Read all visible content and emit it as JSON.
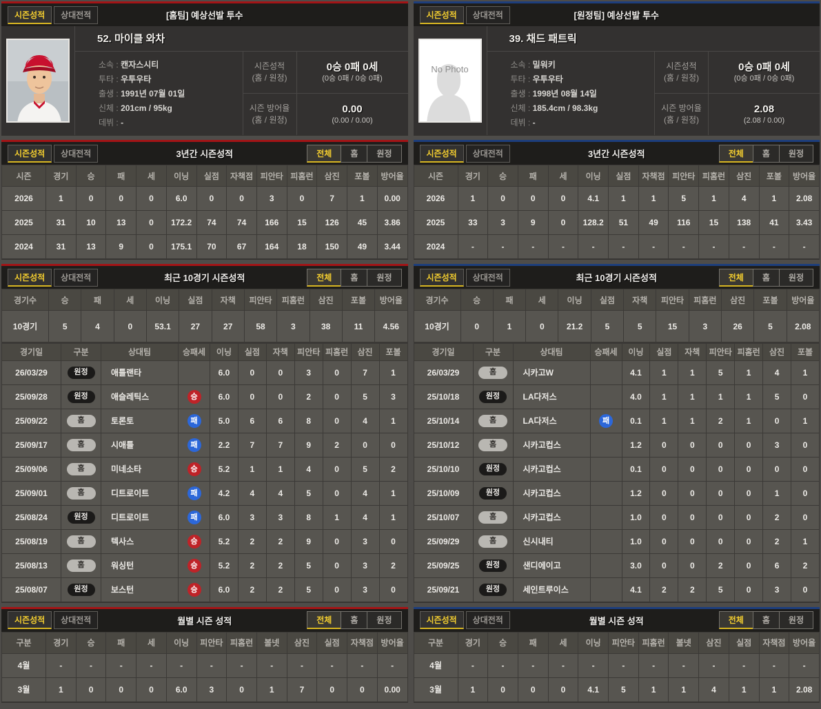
{
  "colors": {
    "accent-red": "#a31416",
    "accent-blue": "#1d3e7c",
    "tab-active": "#f4ce2f",
    "win-red": "#bf2328",
    "lose-blue": "#2c67d9",
    "page-bg": "#4e4c49",
    "bar-bg": "#1e1d1b"
  },
  "panels": [
    {
      "id": "home",
      "tabs": [
        "시즌성적",
        "상대전적"
      ],
      "filters": [
        "전체",
        "홈",
        "원정"
      ],
      "header_title": "[홈팀] 예상선발 투수",
      "player": {
        "name": "52. 마이클 와차",
        "info": [
          {
            "label": "소속",
            "value": "캔자스시티"
          },
          {
            "label": "투타",
            "value": "우투우타"
          },
          {
            "label": "출생",
            "value": "1991년 07월 01일"
          },
          {
            "label": "신체",
            "value": "201cm / 95kg"
          },
          {
            "label": "데뷔",
            "value": "-"
          }
        ],
        "season_record": {
          "label": "시즌성적",
          "sublabel": "(홈 / 원정)",
          "value": "0승 0패 0세",
          "detail": "(0승 0패 / 0승 0패)"
        },
        "season_era": {
          "label": "시즌 방어율",
          "sublabel": "(홈 / 원정)",
          "value": "0.00",
          "detail": "(0.00 / 0.00)"
        }
      },
      "three_year": {
        "title": "3년간 시즌성적",
        "headers": [
          "시즌",
          "경기",
          "승",
          "패",
          "세",
          "이닝",
          "실점",
          "자책점",
          "피안타",
          "피홈런",
          "삼진",
          "포볼",
          "방어율"
        ],
        "rows": [
          [
            "2026",
            "1",
            "0",
            "0",
            "0",
            "6.0",
            "0",
            "0",
            "3",
            "0",
            "7",
            "1",
            "0.00"
          ],
          [
            "2025",
            "31",
            "10",
            "13",
            "0",
            "172.2",
            "74",
            "74",
            "166",
            "15",
            "126",
            "45",
            "3.86"
          ],
          [
            "2024",
            "31",
            "13",
            "9",
            "0",
            "175.1",
            "70",
            "67",
            "164",
            "18",
            "150",
            "49",
            "3.44"
          ]
        ]
      },
      "recent10": {
        "title": "최근 10경기 시즌성적"
      },
      "recent10_summary": {
        "headers": [
          "경기수",
          "승",
          "패",
          "세",
          "이닝",
          "실점",
          "자책",
          "피안타",
          "피홈런",
          "삼진",
          "포볼",
          "방어율"
        ],
        "rows": [
          [
            "10경기",
            "5",
            "4",
            "0",
            "53.1",
            "27",
            "27",
            "58",
            "3",
            "38",
            "11",
            "4.56"
          ]
        ]
      },
      "game_log": {
        "headers": [
          "경기일",
          "구분",
          "상대팀",
          "승패세",
          "이닝",
          "실점",
          "자책",
          "피안타",
          "피홈런",
          "삼진",
          "포볼"
        ],
        "rows": [
          [
            "26/03/29",
            {
              "pill": "원정"
            },
            "애틀랜타",
            "",
            "6.0",
            "0",
            "0",
            "3",
            "0",
            "7",
            "1"
          ],
          [
            "25/09/28",
            {
              "pill": "원정"
            },
            "애슬레틱스",
            {
              "circle": "승"
            },
            "6.0",
            "0",
            "0",
            "2",
            "0",
            "5",
            "3"
          ],
          [
            "25/09/22",
            {
              "pill": "홈"
            },
            "토론토",
            {
              "circle": "패"
            },
            "5.0",
            "6",
            "6",
            "8",
            "0",
            "4",
            "1"
          ],
          [
            "25/09/17",
            {
              "pill": "홈"
            },
            "시애틀",
            {
              "circle": "패"
            },
            "2.2",
            "7",
            "7",
            "9",
            "2",
            "0",
            "0"
          ],
          [
            "25/09/06",
            {
              "pill": "홈"
            },
            "미네소타",
            {
              "circle": "승"
            },
            "5.2",
            "1",
            "1",
            "4",
            "0",
            "5",
            "2"
          ],
          [
            "25/09/01",
            {
              "pill": "홈"
            },
            "디트로이트",
            {
              "circle": "패"
            },
            "4.2",
            "4",
            "4",
            "5",
            "0",
            "4",
            "1"
          ],
          [
            "25/08/24",
            {
              "pill": "원정"
            },
            "디트로이트",
            {
              "circle": "패"
            },
            "6.0",
            "3",
            "3",
            "8",
            "1",
            "4",
            "1"
          ],
          [
            "25/08/19",
            {
              "pill": "홈"
            },
            "텍사스",
            {
              "circle": "승"
            },
            "5.2",
            "2",
            "2",
            "9",
            "0",
            "3",
            "0"
          ],
          [
            "25/08/13",
            {
              "pill": "홈"
            },
            "워싱턴",
            {
              "circle": "승"
            },
            "5.2",
            "2",
            "2",
            "5",
            "0",
            "3",
            "2"
          ],
          [
            "25/08/07",
            {
              "pill": "원정"
            },
            "보스턴",
            {
              "circle": "승"
            },
            "6.0",
            "2",
            "2",
            "5",
            "0",
            "3",
            "0"
          ]
        ]
      },
      "monthly": {
        "title": "월별 시즌 성적",
        "headers": [
          "구분",
          "경기",
          "승",
          "패",
          "세",
          "이닝",
          "피안타",
          "피홈런",
          "볼넷",
          "삼진",
          "실점",
          "자책점",
          "방어율"
        ],
        "rows": [
          [
            "4월",
            "-",
            "-",
            "-",
            "-",
            "-",
            "-",
            "-",
            "-",
            "-",
            "-",
            "-",
            "-"
          ],
          [
            "3월",
            "1",
            "0",
            "0",
            "0",
            "6.0",
            "3",
            "0",
            "1",
            "7",
            "0",
            "0",
            "0.00"
          ]
        ]
      }
    },
    {
      "id": "away",
      "tabs": [
        "시즌성적",
        "상대전적"
      ],
      "filters": [
        "전체",
        "홈",
        "원정"
      ],
      "header_title": "[원정팀] 예상선발 투수",
      "player": {
        "name": "39. 채드 패트릭",
        "photo_text": "No Photo",
        "info": [
          {
            "label": "소속",
            "value": "밀워키"
          },
          {
            "label": "투타",
            "value": "우투우타"
          },
          {
            "label": "출생",
            "value": "1998년 08월 14일"
          },
          {
            "label": "신체",
            "value": "185.4cm / 98.3kg"
          },
          {
            "label": "데뷔",
            "value": "-"
          }
        ],
        "season_record": {
          "label": "시즌성적",
          "sublabel": "(홈 / 원정)",
          "value": "0승 0패 0세",
          "detail": "(0승 0패 / 0승 0패)"
        },
        "season_era": {
          "label": "시즌 방어율",
          "sublabel": "(홈 / 원정)",
          "value": "2.08",
          "detail": "(2.08 / 0.00)"
        }
      },
      "three_year": {
        "title": "3년간 시즌성적",
        "headers": [
          "시즌",
          "경기",
          "승",
          "패",
          "세",
          "이닝",
          "실점",
          "자책점",
          "피안타",
          "피홈런",
          "삼진",
          "포볼",
          "방어율"
        ],
        "rows": [
          [
            "2026",
            "1",
            "0",
            "0",
            "0",
            "4.1",
            "1",
            "1",
            "5",
            "1",
            "4",
            "1",
            "2.08"
          ],
          [
            "2025",
            "33",
            "3",
            "9",
            "0",
            "128.2",
            "51",
            "49",
            "116",
            "15",
            "138",
            "41",
            "3.43"
          ],
          [
            "2024",
            "-",
            "-",
            "-",
            "-",
            "-",
            "-",
            "-",
            "-",
            "-",
            "-",
            "-",
            "-"
          ]
        ]
      },
      "recent10": {
        "title": "최근 10경기 시즌성적"
      },
      "recent10_summary": {
        "headers": [
          "경기수",
          "승",
          "패",
          "세",
          "이닝",
          "실점",
          "자책",
          "피안타",
          "피홈런",
          "삼진",
          "포볼",
          "방어율"
        ],
        "rows": [
          [
            "10경기",
            "0",
            "1",
            "0",
            "21.2",
            "5",
            "5",
            "15",
            "3",
            "26",
            "5",
            "2.08"
          ]
        ]
      },
      "game_log": {
        "headers": [
          "경기일",
          "구분",
          "상대팀",
          "승패세",
          "이닝",
          "실점",
          "자책",
          "피안타",
          "피홈런",
          "삼진",
          "포볼"
        ],
        "rows": [
          [
            "26/03/29",
            {
              "pill": "홈"
            },
            "시카고W",
            "",
            "4.1",
            "1",
            "1",
            "5",
            "1",
            "4",
            "1"
          ],
          [
            "25/10/18",
            {
              "pill": "원정"
            },
            "LA다저스",
            "",
            "4.0",
            "1",
            "1",
            "1",
            "1",
            "5",
            "0"
          ],
          [
            "25/10/14",
            {
              "pill": "홈"
            },
            "LA다저스",
            {
              "circle": "패"
            },
            "0.1",
            "1",
            "1",
            "2",
            "1",
            "0",
            "1"
          ],
          [
            "25/10/12",
            {
              "pill": "홈"
            },
            "시카고컵스",
            "",
            "1.2",
            "0",
            "0",
            "0",
            "0",
            "3",
            "0"
          ],
          [
            "25/10/10",
            {
              "pill": "원정"
            },
            "시카고컵스",
            "",
            "0.1",
            "0",
            "0",
            "0",
            "0",
            "0",
            "0"
          ],
          [
            "25/10/09",
            {
              "pill": "원정"
            },
            "시카고컵스",
            "",
            "1.2",
            "0",
            "0",
            "0",
            "0",
            "1",
            "0"
          ],
          [
            "25/10/07",
            {
              "pill": "홈"
            },
            "시카고컵스",
            "",
            "1.0",
            "0",
            "0",
            "0",
            "0",
            "2",
            "0"
          ],
          [
            "25/09/29",
            {
              "pill": "홈"
            },
            "신시내티",
            "",
            "1.0",
            "0",
            "0",
            "0",
            "0",
            "2",
            "1"
          ],
          [
            "25/09/25",
            {
              "pill": "원정"
            },
            "샌디에이고",
            "",
            "3.0",
            "0",
            "0",
            "2",
            "0",
            "6",
            "2"
          ],
          [
            "25/09/21",
            {
              "pill": "원정"
            },
            "세인트루이스",
            "",
            "4.1",
            "2",
            "2",
            "5",
            "0",
            "3",
            "0"
          ]
        ]
      },
      "monthly": {
        "title": "월별 시즌 성적",
        "headers": [
          "구분",
          "경기",
          "승",
          "패",
          "세",
          "이닝",
          "피안타",
          "피홈런",
          "볼넷",
          "삼진",
          "실점",
          "자책점",
          "방어율"
        ],
        "rows": [
          [
            "4월",
            "-",
            "-",
            "-",
            "-",
            "-",
            "-",
            "-",
            "-",
            "-",
            "-",
            "-",
            "-"
          ],
          [
            "3월",
            "1",
            "0",
            "0",
            "0",
            "4.1",
            "5",
            "1",
            "1",
            "4",
            "1",
            "1",
            "2.08"
          ]
        ]
      }
    }
  ]
}
